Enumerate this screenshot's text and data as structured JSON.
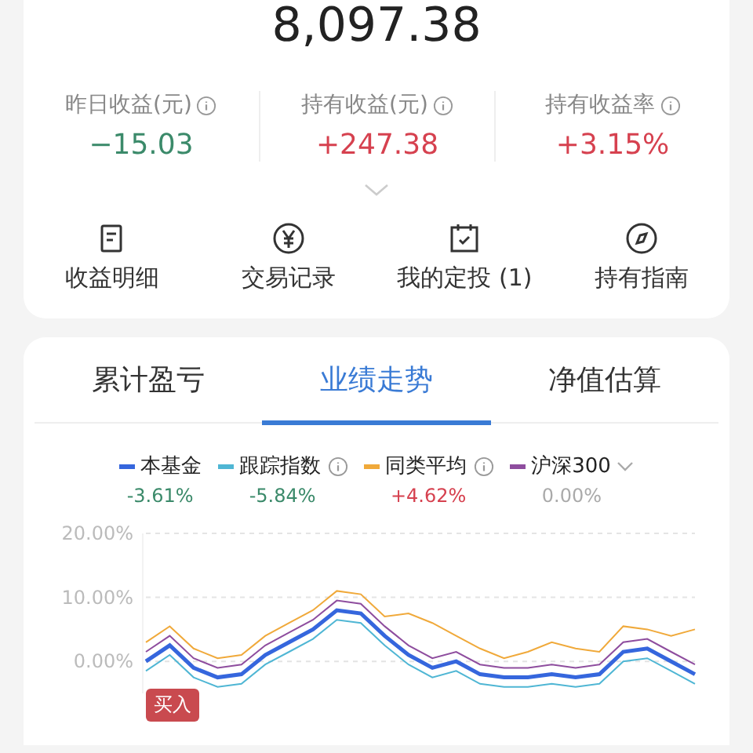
{
  "total": "8,097.38",
  "stats": [
    {
      "label": "昨日收益(元)",
      "info": true,
      "value": {
        "text": "−15.03",
        "color": "#3b8a6a"
      }
    },
    {
      "label": "持有收益(元)",
      "info": true,
      "value": {
        "text": "+247.38",
        "color": "#d6414f"
      }
    },
    {
      "label": "持有收益率",
      "info": true,
      "value": {
        "text": "+3.15%",
        "color": "#d6414f"
      }
    }
  ],
  "actions": [
    {
      "kind": "document",
      "label": "收益明细"
    },
    {
      "kind": "yen",
      "label": "交易记录"
    },
    {
      "kind": "calendar",
      "label": "我的定投 (1)"
    },
    {
      "kind": "compass",
      "label": "持有指南"
    }
  ],
  "tabs": [
    {
      "label": "累计盈亏",
      "selected": false
    },
    {
      "label": "业绩走势",
      "selected": true
    },
    {
      "label": "净值估算",
      "selected": false
    }
  ],
  "legend": [
    {
      "info": false,
      "dropdown": false,
      "value": {
        "text": "-3.61%",
        "color": "#3b8a6a"
      }
    },
    {
      "info": true,
      "dropdown": false,
      "value": {
        "text": "-5.84%",
        "color": "#3b8a6a"
      }
    },
    {
      "info": true,
      "dropdown": false,
      "value": {
        "text": "+4.62%",
        "color": "#d6414f"
      }
    },
    {
      "info": false,
      "dropdown": true,
      "value": {
        "text": "0.00%",
        "color": "#aaaaaa"
      }
    }
  ],
  "chart_data": {
    "type": "line",
    "grid": true,
    "ylim": [
      -5,
      20
    ],
    "yticks": [
      {
        "value": 20,
        "label": "20.00%"
      },
      {
        "value": 10,
        "label": "10.00%"
      },
      {
        "value": 0,
        "label": "0.00%"
      }
    ],
    "series": [
      {
        "name": "本基金",
        "color": "#3566dd",
        "values": [
          0,
          2.5,
          -1,
          -2.5,
          -2,
          1,
          3,
          5,
          8,
          7.5,
          4,
          1,
          -1,
          0,
          -2,
          -2.5,
          -2.5,
          -2,
          -2.5,
          -2,
          1.5,
          2,
          0,
          -2
        ]
      },
      {
        "name": "跟踪指数",
        "color": "#4fb6d4",
        "values": [
          -1.5,
          1,
          -2.5,
          -4,
          -3.5,
          -0.5,
          1.5,
          3.5,
          6.5,
          6,
          2.5,
          -0.5,
          -2.5,
          -1.5,
          -3.5,
          -4,
          -4,
          -3.5,
          -4,
          -3.5,
          0,
          0.5,
          -1.5,
          -3.5
        ]
      },
      {
        "name": "同类平均",
        "color": "#f0a93a",
        "values": [
          3,
          5.5,
          2,
          0.5,
          1,
          4,
          6,
          8,
          11,
          10.5,
          7,
          7.5,
          6,
          4,
          2,
          0.5,
          1.5,
          3,
          2,
          1.5,
          5.5,
          5,
          4,
          5
        ]
      },
      {
        "name": "沪深300",
        "color": "#8e4d9e",
        "values": [
          1.5,
          4,
          0.5,
          -1,
          -0.5,
          2.5,
          4.5,
          6.5,
          9.5,
          9,
          5.5,
          2.5,
          0.5,
          1.5,
          -0.5,
          -1,
          -1,
          -0.5,
          -1,
          -0.5,
          3,
          3.5,
          1.5,
          -0.5
        ]
      }
    ]
  },
  "buy_marker": "买入"
}
